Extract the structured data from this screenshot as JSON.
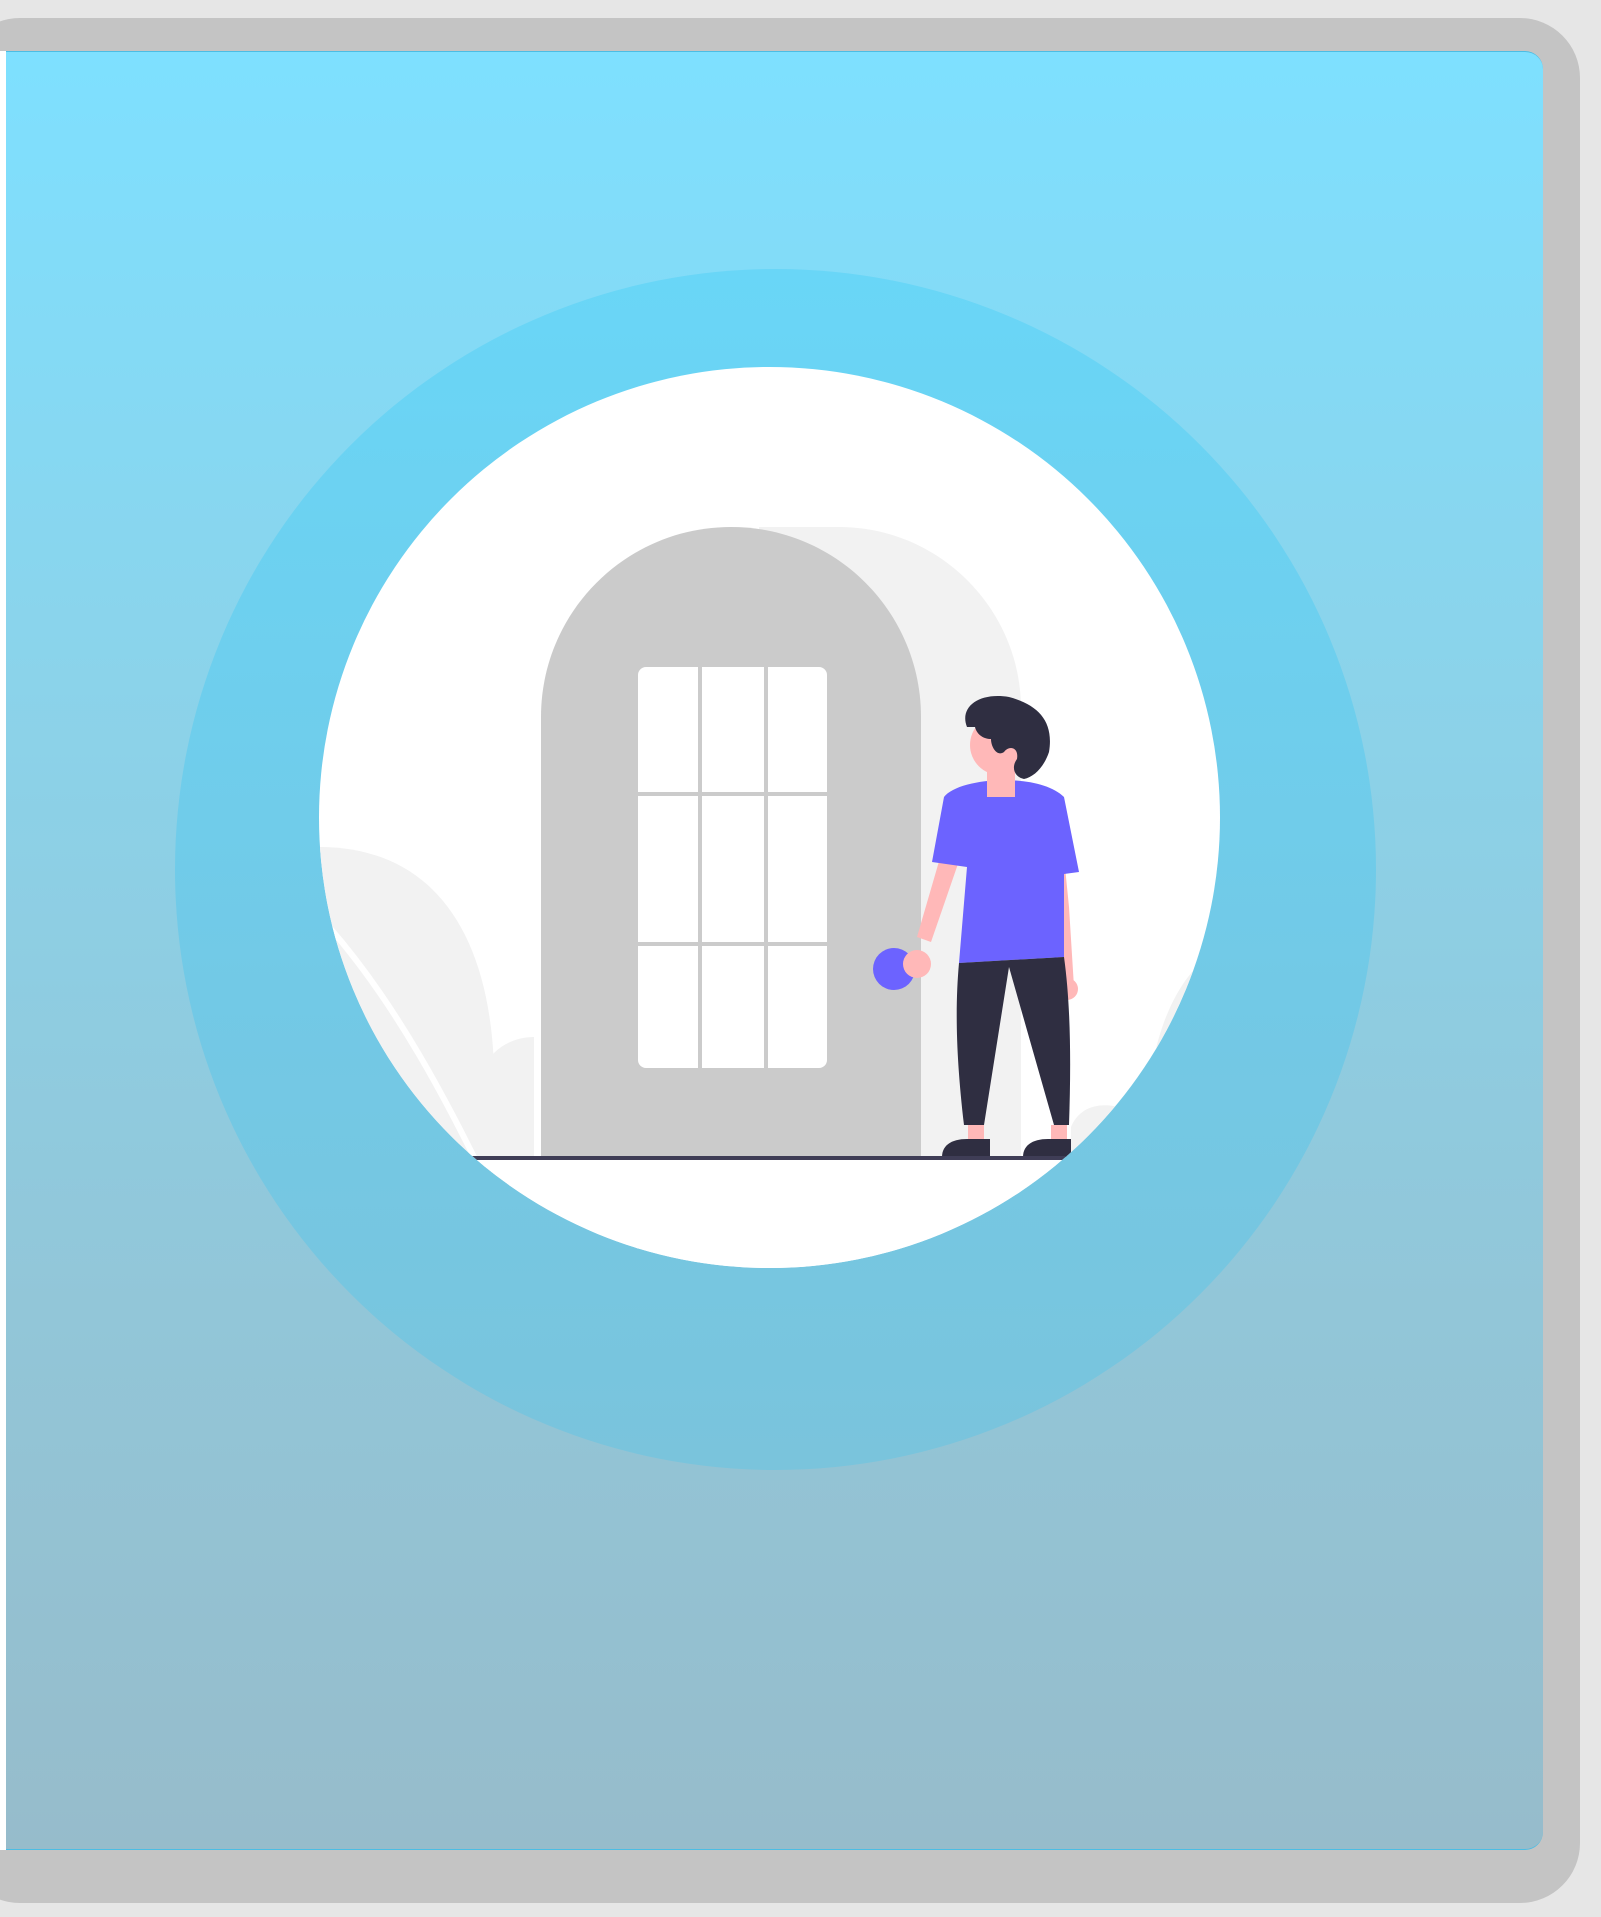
{
  "window": {
    "frame_color": "#c4c4c4",
    "background_color": "#e6e6e6"
  },
  "hero": {
    "gradient_colors": [
      "#7ee0ff",
      "#8bd3ea",
      "#92c6d8",
      "#96bccb"
    ],
    "ring_color": "#6fd0f0",
    "disc_color": "#ffffff",
    "illustration": {
      "subject": "person-opening-door",
      "door_color": "#cbcbcb",
      "door_shadow_color": "#f2f2f2",
      "shirt_color": "#6c63ff",
      "pants_color": "#2f2e41",
      "skin_color": "#ffb8b8",
      "knob_color": "#6c63ff",
      "ground_color": "#3f3d56"
    }
  }
}
